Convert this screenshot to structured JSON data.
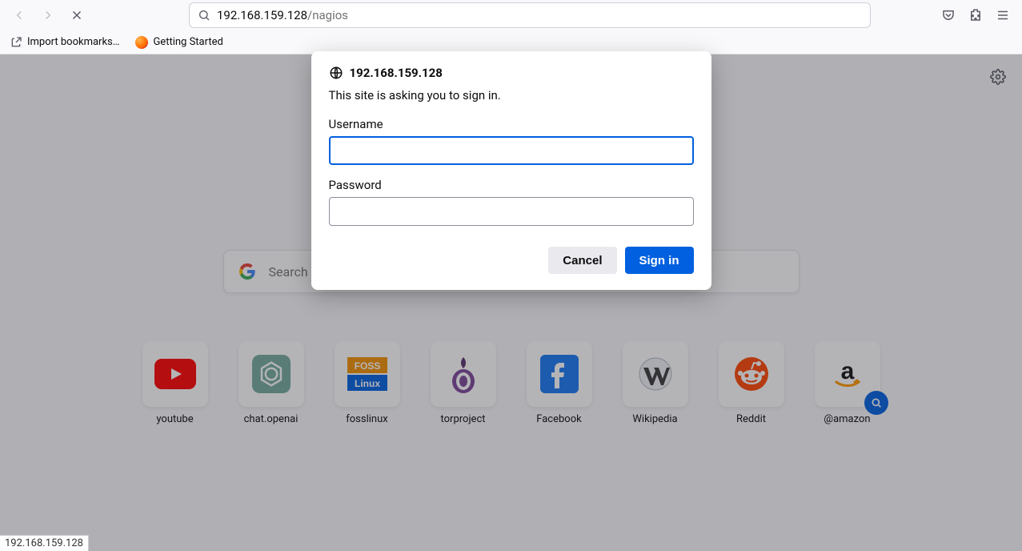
{
  "url": {
    "host": "192.168.159.128",
    "path": "/nagios"
  },
  "bookmarks": {
    "import": "Import bookmarks…",
    "getting_started": "Getting Started"
  },
  "search": {
    "placeholder": "Search w"
  },
  "auth_dialog": {
    "host": "192.168.159.128",
    "message": "This site is asking you to sign in.",
    "username_label": "Username",
    "password_label": "Password",
    "username_value": "",
    "password_value": "",
    "cancel": "Cancel",
    "signin": "Sign in"
  },
  "topsites": [
    {
      "name": "youtube",
      "label": "youtube"
    },
    {
      "name": "chat-openai",
      "label": "chat.openai"
    },
    {
      "name": "fosslinux",
      "label": "fosslinux"
    },
    {
      "name": "torproject",
      "label": "torproject"
    },
    {
      "name": "facebook",
      "label": "Facebook"
    },
    {
      "name": "wikipedia",
      "label": "Wikipedia"
    },
    {
      "name": "reddit",
      "label": "Reddit"
    },
    {
      "name": "amazon",
      "label": "@amazon"
    }
  ],
  "status_text": "192.168.159.128"
}
